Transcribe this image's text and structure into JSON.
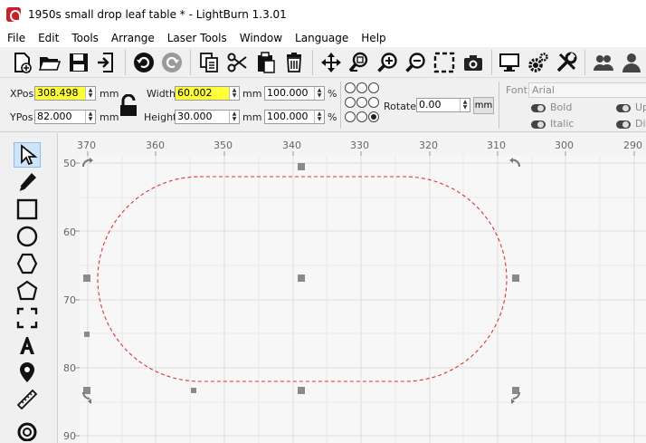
{
  "window": {
    "title": "1950s small drop leaf table * - LightBurn 1.3.01"
  },
  "menu": [
    "File",
    "Edit",
    "Tools",
    "Arrange",
    "Laser Tools",
    "Window",
    "Language",
    "Help"
  ],
  "toolbar": {
    "icons": [
      "new-file-icon",
      "open-folder-icon",
      "save-icon",
      "import-icon",
      "undo-icon",
      "redo-icon",
      "copy-icon",
      "cut-icon",
      "paste-icon",
      "delete-icon",
      "move-icon",
      "zoom-in-selection-icon",
      "zoom-in-icon",
      "zoom-out-icon",
      "frame-select-icon",
      "camera-icon",
      "monitor-icon",
      "settings-icon",
      "tools-icon",
      "users-icon",
      "user-icon"
    ]
  },
  "edit": {
    "xpos_label": "XPos",
    "xpos_value": "308.498",
    "ypos_label": "YPos",
    "ypos_value": "82.000",
    "unit_mm": "mm",
    "width_label": "Width",
    "width_value": "60.002",
    "height_label": "Height",
    "height_value": "30.000",
    "scale_w": "100.000",
    "scale_h": "100.000",
    "percent": "%",
    "rotate_label": "Rotate",
    "rotate_value": "0.00",
    "mm_button": "mm",
    "font_label": "Font",
    "font_value": "Arial",
    "bold_label": "Bold",
    "italic_label": "Italic",
    "up_label": "Up",
    "dis_label": "Dis"
  },
  "tools": [
    "select-tool-icon",
    "pen-tool-icon",
    "rectangle-tool-icon",
    "ellipse-tool-icon",
    "polygon-tool-icon",
    "edit-nodes-icon",
    "frame-corners-icon",
    "text-tool-icon",
    "position-laser-icon",
    "measure-tool-icon",
    "tab-tool-icon"
  ],
  "ruler": {
    "x_ticks": [
      "370",
      "360",
      "350",
      "340",
      "330",
      "320",
      "310",
      "300",
      "290"
    ],
    "y_ticks": [
      "50",
      "60",
      "70",
      "80",
      "90"
    ]
  },
  "colors": {
    "highlight": "#ffff3a",
    "shape_stroke": "#e03030",
    "handle": "#808080",
    "grid": "#dcdcdc"
  }
}
